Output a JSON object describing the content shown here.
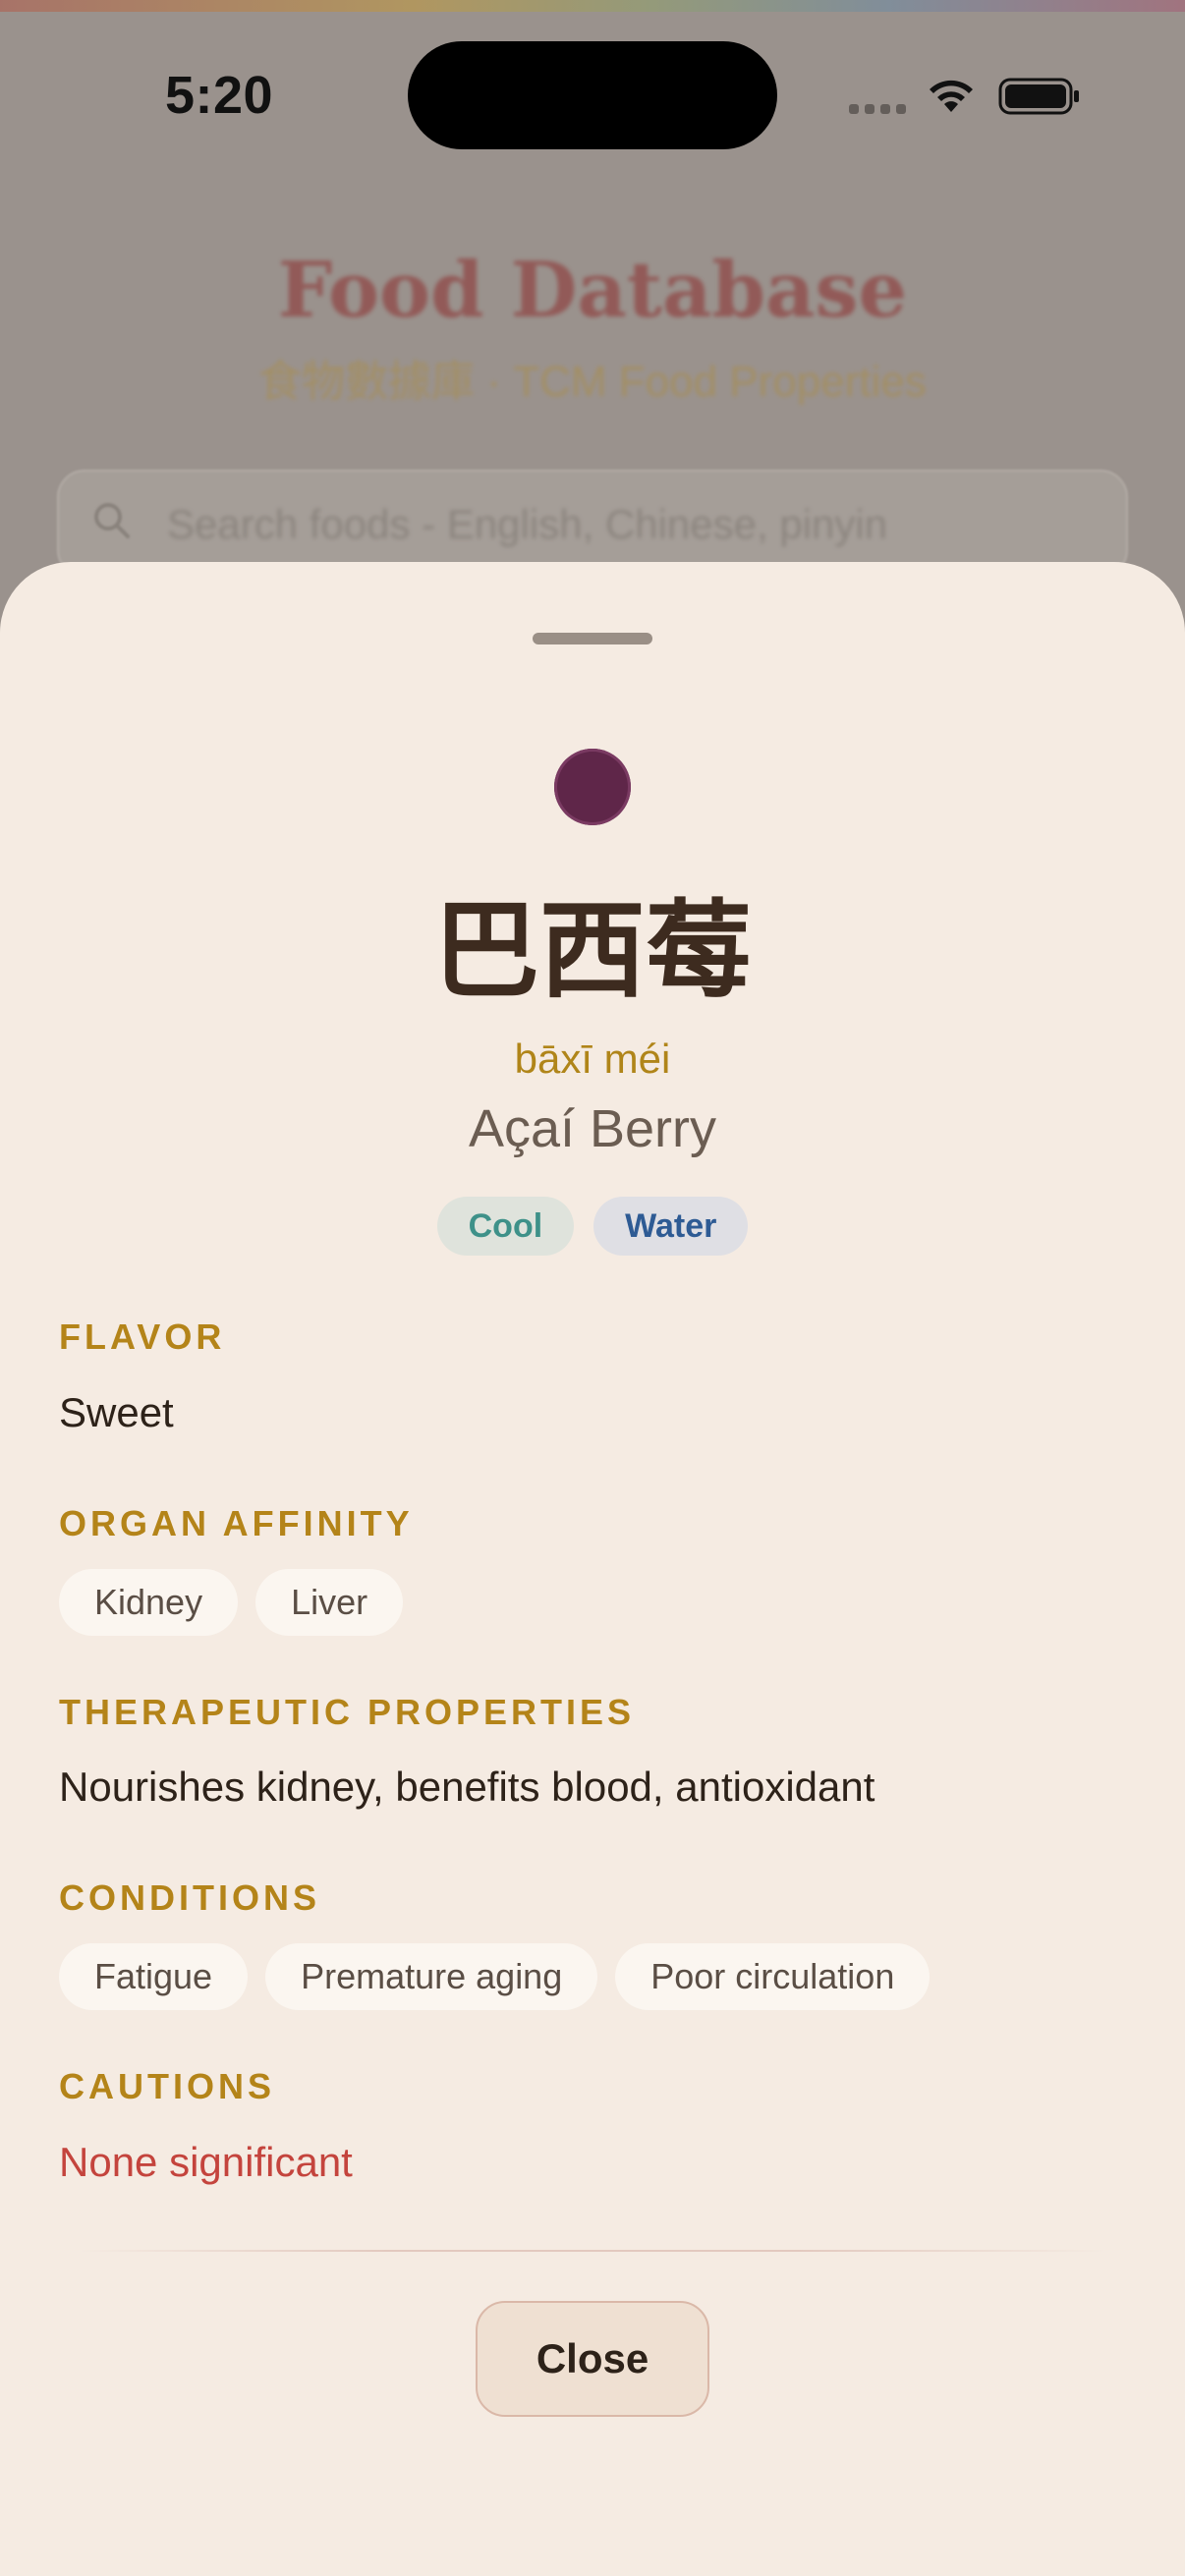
{
  "status_bar": {
    "time": "5:20",
    "icons": [
      "cellular-signal-icon",
      "wifi-icon",
      "battery-icon"
    ]
  },
  "background_page": {
    "title": "Food Database",
    "subtitle": "食物數據庫 · TCM Food Properties",
    "search_placeholder": "Search foods - English, Chinese, pinyin"
  },
  "sheet": {
    "food_color": "#5f2649",
    "chinese_name": "巴西莓",
    "pinyin": "bāxī méi",
    "english_name": "Açaí Berry",
    "tags": [
      {
        "label": "Cool",
        "color": "#3e9189"
      },
      {
        "label": "Water",
        "color": "#2e5b94"
      }
    ],
    "flavor": {
      "label": "FLAVOR",
      "value": "Sweet"
    },
    "organ_affinity": {
      "label": "ORGAN AFFINITY",
      "items": [
        "Kidney",
        "Liver"
      ]
    },
    "therapeutic": {
      "label": "THERAPEUTIC PROPERTIES",
      "value": "Nourishes kidney, benefits blood, antioxidant"
    },
    "conditions": {
      "label": "CONDITIONS",
      "items": [
        "Fatigue",
        "Premature aging",
        "Poor circulation"
      ]
    },
    "cautions": {
      "label": "CAUTIONS",
      "value": "None significant"
    },
    "close_label": "Close"
  },
  "colors": {
    "accent_gold": "#b48419",
    "caution_red": "#c4443d",
    "sheet_bg": "#f5ebe2"
  }
}
